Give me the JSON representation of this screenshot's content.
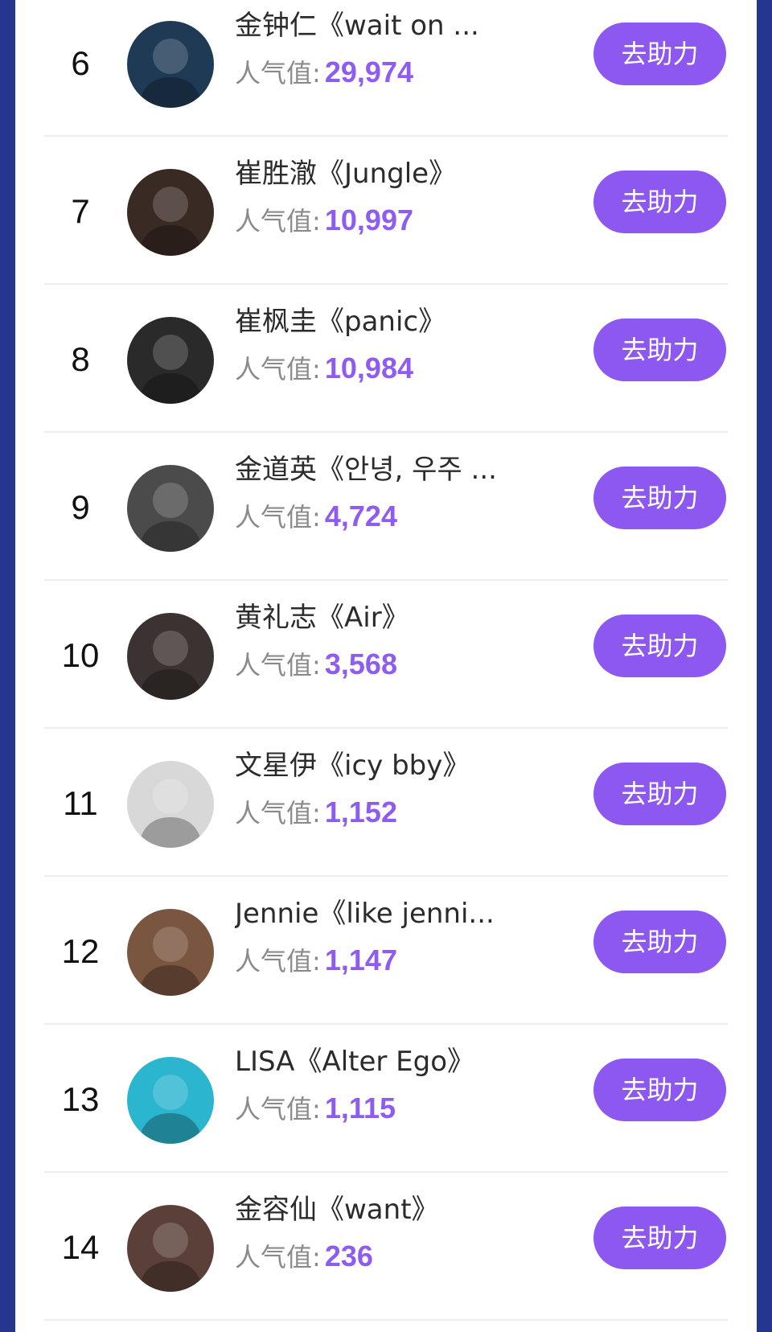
{
  "list": {
    "help_label": "去助力",
    "popularity_label": "人气值:",
    "items": [
      {
        "rank": "6",
        "title": "金钟仁《wait on ...",
        "popularity": "29,974",
        "avatar_color": "#1f3a55"
      },
      {
        "rank": "7",
        "title": "崔胜澈《Jungle》",
        "popularity": "10,997",
        "avatar_color": "#3a2a24"
      },
      {
        "rank": "8",
        "title": "崔枫圭《panic》",
        "popularity": "10,984",
        "avatar_color": "#2a2a2a"
      },
      {
        "rank": "9",
        "title": "金道英《안녕, 우주 ...",
        "popularity": "4,724",
        "avatar_color": "#4b4b4b"
      },
      {
        "rank": "10",
        "title": "黄礼志《Air》",
        "popularity": "3,568",
        "avatar_color": "#3b3331"
      },
      {
        "rank": "11",
        "title": "文星伊《icy bby》",
        "popularity": "1,152",
        "avatar_color": "#d8d8d8"
      },
      {
        "rank": "12",
        "title": "Jennie《like jenni...",
        "popularity": "1,147",
        "avatar_color": "#7a5540"
      },
      {
        "rank": "13",
        "title": "LISA《Alter Ego》",
        "popularity": "1,115",
        "avatar_color": "#2bb5cf"
      },
      {
        "rank": "14",
        "title": "金容仙《want》",
        "popularity": "236",
        "avatar_color": "#5a4038"
      }
    ]
  }
}
